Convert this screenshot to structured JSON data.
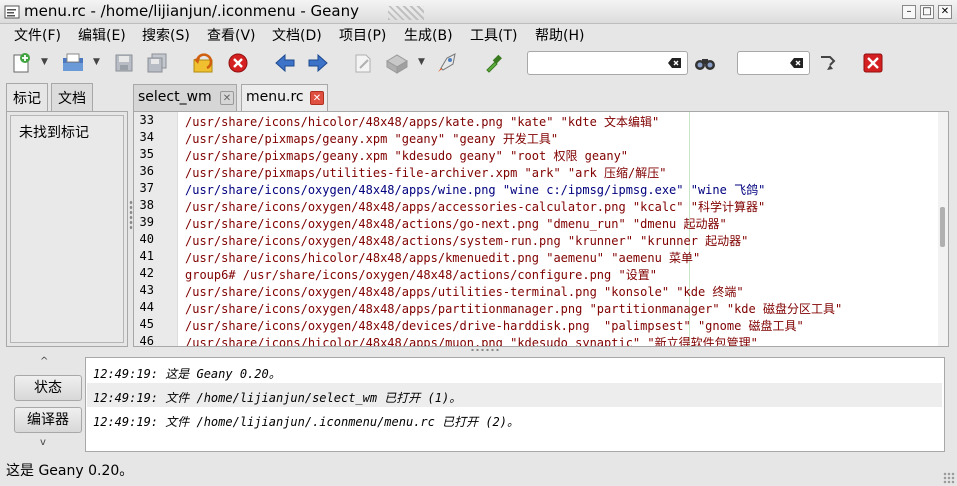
{
  "window": {
    "title": "menu.rc - /home/lijianjun/.iconmenu - Geany",
    "minimize_label": "–",
    "maximize_label": "□",
    "close_label": "✕"
  },
  "menubar": [
    "文件(F)",
    "编辑(E)",
    "搜索(S)",
    "查看(V)",
    "文档(D)",
    "项目(P)",
    "生成(B)",
    "工具(T)",
    "帮助(H)"
  ],
  "toolbar": {
    "icons": [
      "new-file-icon",
      "open-file-icon",
      "save-icon",
      "save-all-icon",
      "revert-icon",
      "close-file-icon",
      "back-icon",
      "forward-icon",
      "compile-icon",
      "build-icon",
      "execute-icon",
      "color-picker-icon",
      "find-icon",
      "goto-line-icon",
      "quit-icon"
    ],
    "search_value": "",
    "goto_value": ""
  },
  "sidebar": {
    "tabs": [
      "标记",
      "文档"
    ],
    "active_tab": "标记",
    "empty_text": "未找到标记"
  },
  "doc_tabs": [
    {
      "label": "select_wm",
      "active": false
    },
    {
      "label": "menu.rc",
      "active": true
    }
  ],
  "editor": {
    "lines": [
      {
        "n": "33",
        "text": "/usr/share/icons/hicolor/48x48/apps/kate.png \"kate\" \"kdte 文本编辑\""
      },
      {
        "n": "34",
        "text": "/usr/share/pixmaps/geany.xpm \"geany\" \"geany 开发工具\""
      },
      {
        "n": "35",
        "text": "/usr/share/pixmaps/geany.xpm \"kdesudo geany\" \"root 权限 geany\""
      },
      {
        "n": "36",
        "text": "/usr/share/pixmaps/utilities-file-archiver.xpm \"ark\" \"ark 压缩/解压\""
      },
      {
        "n": "37",
        "text": "/usr/share/icons/oxygen/48x48/apps/wine.png \"wine c:/ipmsg/ipmsg.exe\" \"wine 飞鸽\""
      },
      {
        "n": "38",
        "text": "/usr/share/icons/oxygen/48x48/apps/accessories-calculator.png \"kcalc\" \"科学计算器\""
      },
      {
        "n": "39",
        "text": "/usr/share/icons/oxygen/48x48/actions/go-next.png \"dmenu_run\" \"dmenu 起动器\""
      },
      {
        "n": "40",
        "text": "/usr/share/icons/oxygen/48x48/actions/system-run.png \"krunner\" \"krunner 起动器\""
      },
      {
        "n": "41",
        "text": "/usr/share/icons/hicolor/48x48/apps/kmenuedit.png \"aemenu\" \"aemenu 菜单\""
      },
      {
        "n": "42",
        "text": "group6# /usr/share/icons/oxygen/48x48/actions/configure.png \"设置\""
      },
      {
        "n": "43",
        "text": "/usr/share/icons/oxygen/48x48/apps/utilities-terminal.png \"konsole\" \"kde 终端\""
      },
      {
        "n": "44",
        "text": "/usr/share/icons/oxygen/48x48/apps/partitionmanager.png \"partitionmanager\" \"kde 磁盘分区工具\""
      },
      {
        "n": "45",
        "text": "/usr/share/icons/oxygen/48x48/devices/drive-harddisk.png  \"palimpsest\" \"gnome 磁盘工具\""
      },
      {
        "n": "46",
        "text": "/usr/share/icons/hicolor/48x48/apps/muon.png \"kdesudo synaptic\" \"新立得软件包管理\""
      }
    ]
  },
  "messages": {
    "tabs": [
      "状态",
      "编译器"
    ],
    "up_arrow": "^",
    "down_arrow": "v",
    "rows": [
      "12:49:19: 这是 Geany 0.20。",
      "12:49:19: 文件 /home/lijianjun/select_wm 已打开 (1)。",
      "12:49:19: 文件 /home/lijianjun/.iconmenu/menu.rc 已打开 (2)。"
    ]
  },
  "status": {
    "text": "这是 Geany 0.20。"
  }
}
